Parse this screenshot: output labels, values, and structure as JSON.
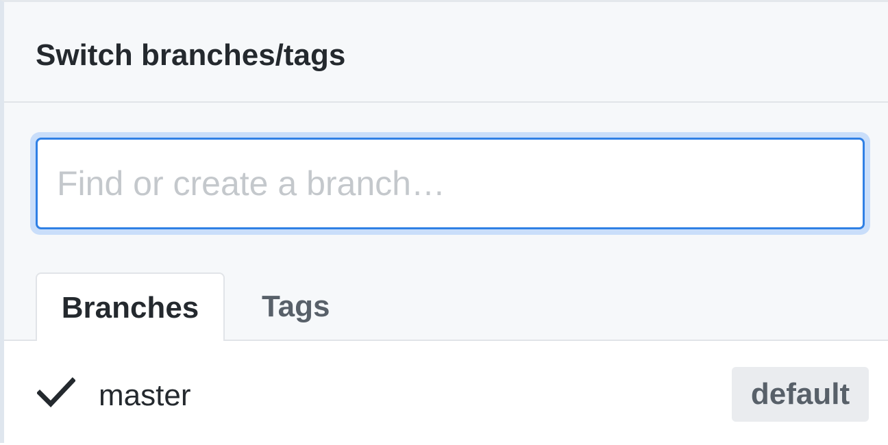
{
  "header": {
    "title": "Switch branches/tags"
  },
  "search": {
    "placeholder": "Find or create a branch…",
    "value": ""
  },
  "tabs": [
    {
      "label": "Branches",
      "selected": true
    },
    {
      "label": "Tags",
      "selected": false
    }
  ],
  "branches": [
    {
      "name": "master",
      "checked": true,
      "badge": "default",
      "check_icon": "check-icon"
    }
  ],
  "colors": {
    "focus_border": "#2f80e5",
    "focus_ring": "#c9defa",
    "header_bg": "#f6f8fa",
    "badge_bg": "#eaecef"
  }
}
